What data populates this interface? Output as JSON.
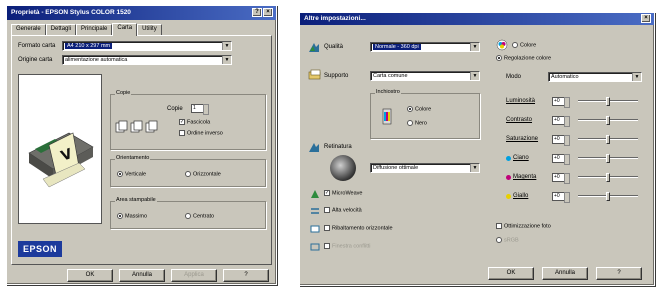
{
  "left_window": {
    "title": "Proprietà - EPSON Stylus COLOR 1520",
    "title_buttons": [
      "?",
      "×"
    ],
    "tabs": [
      "Generale",
      "Dettagli",
      "Principale",
      "Carta",
      "Utility"
    ],
    "active_tab": "Carta",
    "paper_size_label": "Formato carta",
    "paper_size_value": "A4 210 x 297 mm",
    "paper_source_label": "Origine carta",
    "paper_source_value": "alimentazione automatica",
    "copies_group": "Copie",
    "copies_label": "Copie",
    "copies_value": "1",
    "collate_label": "Fascicola",
    "reverse_label": "Ordine inverso",
    "orientation_group": "Orientamento",
    "portrait_label": "Verticale",
    "landscape_label": "Orizzontale",
    "printable_area_group": "Area stampabile",
    "maximum_label": "Massimo",
    "centered_label": "Centrato",
    "logo_text": "EPSON",
    "buttons": [
      "OK",
      "Annulla",
      "Applica",
      "?"
    ]
  },
  "right_window": {
    "title": "Altre impostazioni...",
    "close_label": "×",
    "quality_label": "Qualità",
    "quality_value": "Normale - 360 dpi",
    "media_label": "Supporto",
    "media_value": "Carta comune",
    "ink_group": "Inchiostro",
    "color_radio": "Colore",
    "black_radio": "Nero",
    "halftoning_label": "Retinatura",
    "halftoning_value": "Diffusione ottimale",
    "microweave_label": "MicroWeave",
    "high_speed_label": "Alta velocità",
    "flip_label": "Ribaltamento orizzontale",
    "smooth_label": "Finestra conflitti",
    "color_label": "Colore",
    "color_adjust_label": "Regolazione colore",
    "mode_label": "Modo",
    "mode_value": "Automatico",
    "sliders": [
      {
        "label": "Luminosità",
        "value": "+0",
        "level": 0.5
      },
      {
        "label": "Contrasto",
        "value": "+0",
        "level": 0.5
      },
      {
        "label": "Saturazione",
        "value": "+0",
        "level": 0.5
      },
      {
        "label": "Ciano",
        "value": "+0",
        "level": 0.5
      },
      {
        "label": "Magenta",
        "value": "+0",
        "level": 0.5
      },
      {
        "label": "Giallo",
        "value": "+0",
        "level": 0.5
      }
    ],
    "slider_dot_colors": [
      "",
      "",
      "",
      "#00a0e0",
      "#c0007a",
      "#e8d000"
    ],
    "photo_enhance_label": "Ottimizzazione foto",
    "sub_label": "sRGB",
    "buttons": [
      "OK",
      "Annulla",
      "?"
    ]
  },
  "colors": {
    "title_dark": "#0b1f7a",
    "title_light": "#4a6cc4",
    "window_face": "#c9c6bb",
    "epson_blue": "#1c3a9c"
  }
}
